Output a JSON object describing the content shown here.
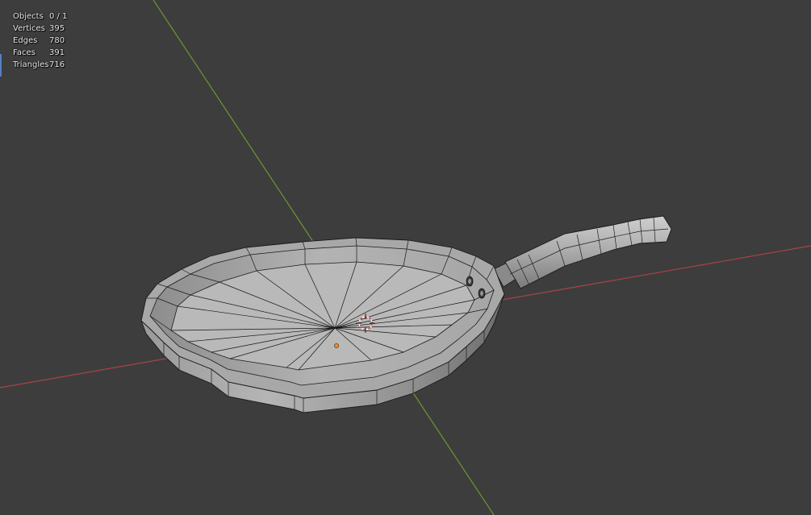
{
  "viewport": {
    "background": "#3d3d3d",
    "x_axis_color": "#a84348",
    "y_axis_color": "#6b9832",
    "origin_color": "#ff8a1c"
  },
  "stats": [
    {
      "label": "Objects",
      "value": "0 / 1"
    },
    {
      "label": "Vertices",
      "value": "395"
    },
    {
      "label": "Edges",
      "value": "780"
    },
    {
      "label": "Faces",
      "value": "391"
    },
    {
      "label": "Triangles",
      "value": "716"
    }
  ],
  "icons": {
    "cursor": "3d-cursor-icon",
    "origin": "object-origin-icon"
  }
}
